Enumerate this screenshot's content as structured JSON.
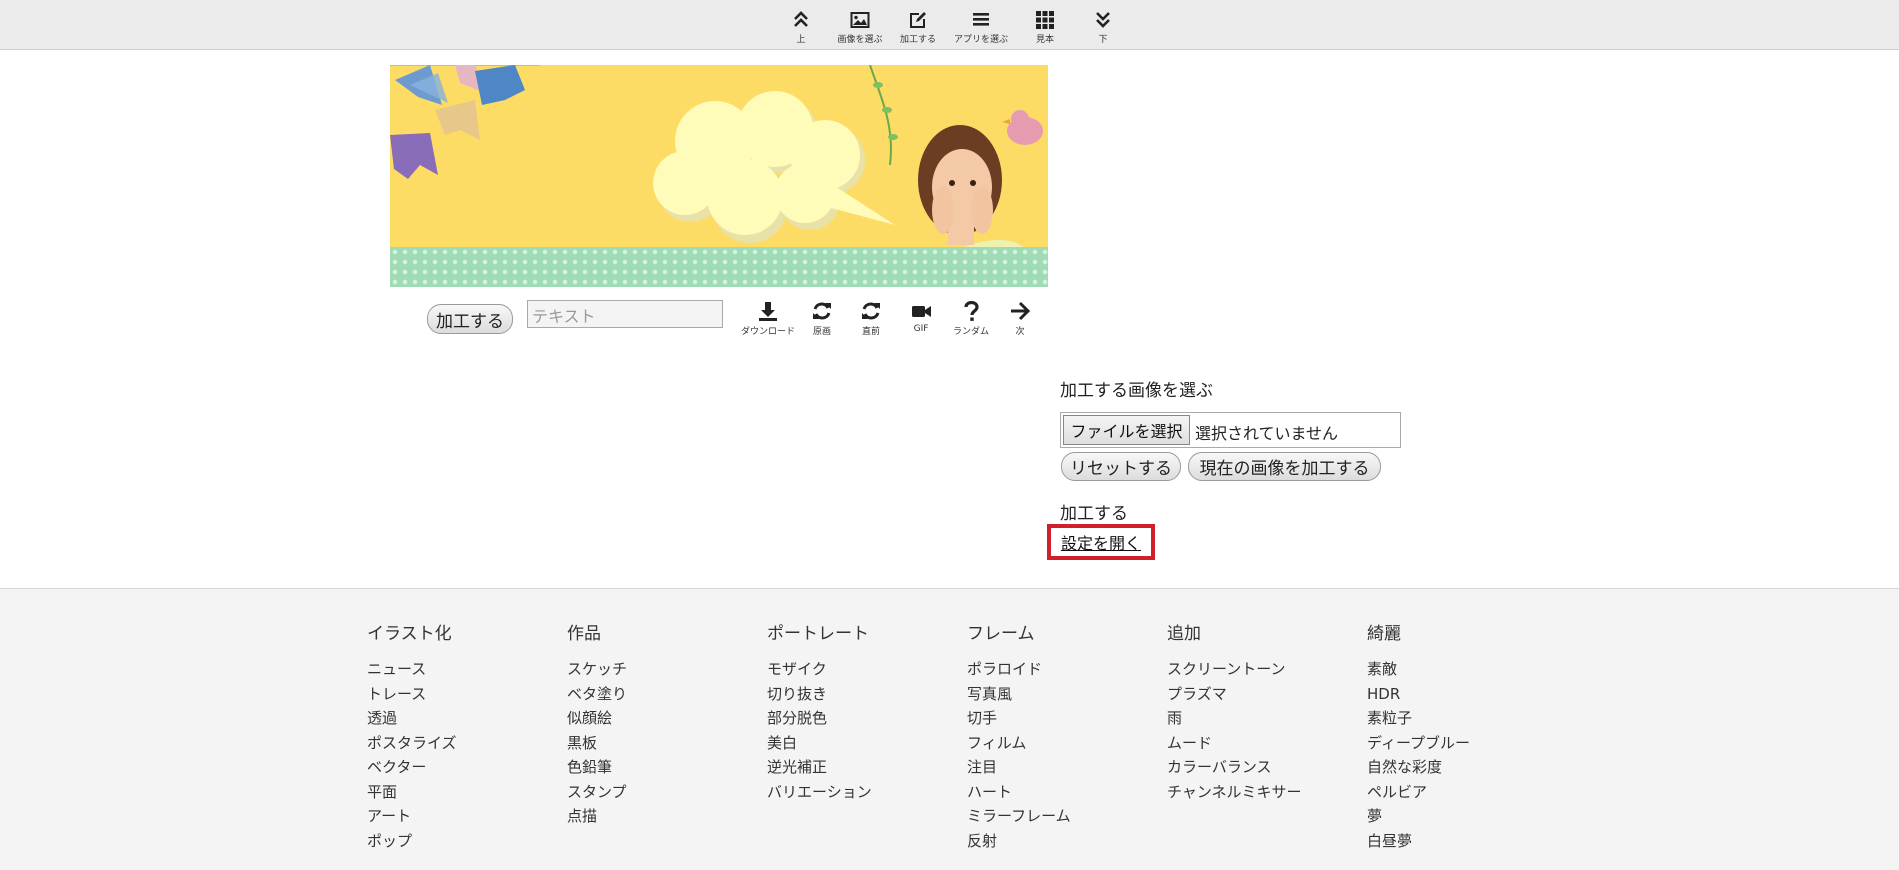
{
  "toolbar": {
    "items": [
      {
        "label": "上",
        "icon": "double-chevron-up-icon"
      },
      {
        "label": "画像を選ぶ",
        "icon": "image-icon"
      },
      {
        "label": "加工する",
        "icon": "edit-icon"
      },
      {
        "label": "アプリを選ぶ",
        "icon": "list-icon"
      },
      {
        "label": "見本",
        "icon": "grid-icon"
      },
      {
        "label": "下",
        "icon": "double-chevron-down-icon"
      }
    ]
  },
  "banner": {
    "colors": {
      "background": "#fddc66",
      "cloud": "#fffbb8",
      "dots": "#9fdcb6"
    }
  },
  "image_actions": {
    "process_button": "加工する",
    "text_placeholder": "テキスト",
    "buttons": [
      {
        "label": "ダウンロード",
        "icon": "download-icon"
      },
      {
        "label": "原画",
        "icon": "refresh-icon"
      },
      {
        "label": "直前",
        "icon": "refresh-icon"
      },
      {
        "label": "GIF",
        "icon": "video-camera-icon"
      },
      {
        "label": "ランダム",
        "icon": "question-icon"
      },
      {
        "label": "次",
        "icon": "arrow-right-icon"
      }
    ]
  },
  "panel": {
    "choose_heading": "加工する画像を選ぶ",
    "file_button": "ファイルを選択",
    "file_status": "選択されていません",
    "reset_button": "リセットする",
    "process_current_button": "現在の画像を加工する",
    "process_heading": "加工する",
    "open_settings_link": "設定を開く",
    "highlight_color": "#d0202b"
  },
  "footer": {
    "columns": [
      {
        "title": "イラスト化",
        "items": [
          "ニュース",
          "トレース",
          "透過",
          "ポスタライズ",
          "ベクター",
          "平面",
          "アート",
          "ポップ"
        ]
      },
      {
        "title": "作品",
        "items": [
          "スケッチ",
          "ベタ塗り",
          "似顔絵",
          "黒板",
          "色鉛筆",
          "スタンプ",
          "点描"
        ]
      },
      {
        "title": "ポートレート",
        "items": [
          "モザイク",
          "切り抜き",
          "部分脱色",
          "美白",
          "逆光補正",
          "バリエーション"
        ]
      },
      {
        "title": "フレーム",
        "items": [
          "ポラロイド",
          "写真風",
          "切手",
          "フィルム",
          "注目",
          "ハート",
          "ミラーフレーム",
          "反射"
        ]
      },
      {
        "title": "追加",
        "items": [
          "スクリーントーン",
          "プラズマ",
          "雨",
          "ムード",
          "カラーバランス",
          "チャンネルミキサー"
        ]
      },
      {
        "title": "綺麗",
        "items": [
          "素敵",
          "HDR",
          "素粒子",
          "ディープブルー",
          "自然な彩度",
          "ペルビア",
          "夢",
          "白昼夢"
        ]
      }
    ]
  }
}
